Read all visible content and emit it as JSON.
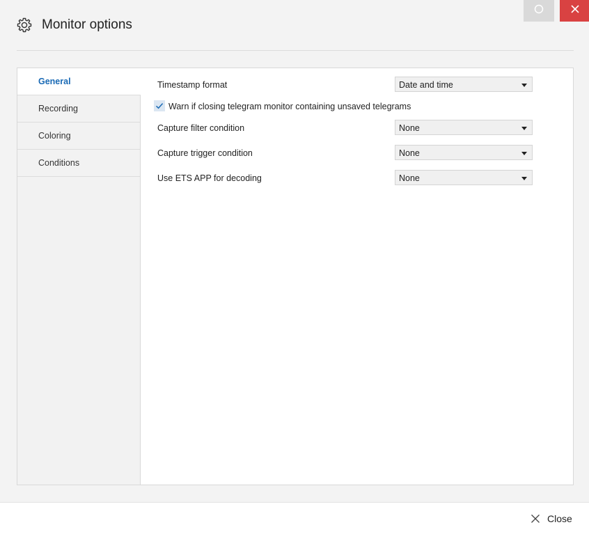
{
  "window": {
    "title": "Monitor options",
    "title_icon": "gear-icon",
    "controls": {
      "restore_icon": "circle-icon",
      "close_icon": "close-icon"
    }
  },
  "sidebar": {
    "items": [
      {
        "label": "General",
        "active": true
      },
      {
        "label": "Recording",
        "active": false
      },
      {
        "label": "Coloring",
        "active": false
      },
      {
        "label": "Conditions",
        "active": false
      }
    ]
  },
  "general": {
    "timestamp": {
      "label": "Timestamp format",
      "value": "Date and time"
    },
    "warn_unsaved": {
      "label": "Warn if closing telegram monitor containing unsaved telegrams",
      "checked": true
    },
    "capture_filter": {
      "label": "Capture filter condition",
      "value": "None"
    },
    "capture_trigger": {
      "label": "Capture trigger condition",
      "value": "None"
    },
    "ets_app": {
      "label": "Use ETS APP for decoding",
      "value": "None"
    }
  },
  "footer": {
    "close_label": "Close"
  },
  "colors": {
    "accent": "#1a6ab5",
    "close_button": "#d94242",
    "checkbox_fill": "#dbe6f2"
  }
}
